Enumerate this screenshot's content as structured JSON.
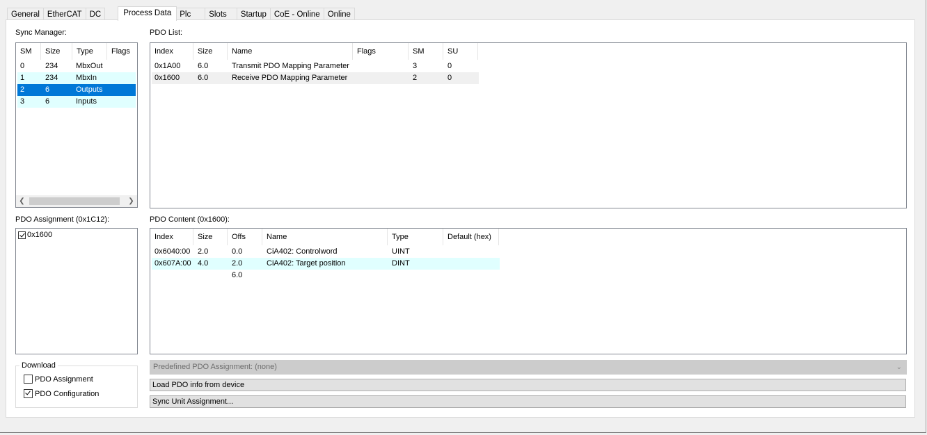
{
  "tabs": [
    "General",
    "EtherCAT",
    "DC",
    "Process Data",
    "Plc",
    "Slots",
    "Startup",
    "CoE - Online",
    "Online"
  ],
  "active_tab": "Process Data",
  "sync_manager": {
    "label": "Sync Manager:",
    "columns": [
      "SM",
      "Size",
      "Type",
      "Flags"
    ],
    "rows": [
      {
        "sm": "0",
        "size": "234",
        "type": "MbxOut",
        "flags": ""
      },
      {
        "sm": "1",
        "size": "234",
        "type": "MbxIn",
        "flags": ""
      },
      {
        "sm": "2",
        "size": "6",
        "type": "Outputs",
        "flags": ""
      },
      {
        "sm": "3",
        "size": "6",
        "type": "Inputs",
        "flags": ""
      }
    ]
  },
  "pdo_list": {
    "label": "PDO List:",
    "columns": [
      "Index",
      "Size",
      "Name",
      "Flags",
      "SM",
      "SU"
    ],
    "rows": [
      {
        "index": "0x1A00",
        "size": "6.0",
        "name": "Transmit PDO Mapping Parameter",
        "flags": "",
        "sm": "3",
        "su": "0"
      },
      {
        "index": "0x1600",
        "size": "6.0",
        "name": "Receive PDO Mapping Parameter",
        "flags": "",
        "sm": "2",
        "su": "0"
      }
    ]
  },
  "pdo_assignment": {
    "label": "PDO Assignment (0x1C12):",
    "items": [
      {
        "label": "0x1600",
        "checked": true
      }
    ]
  },
  "pdo_content": {
    "label": "PDO Content (0x1600):",
    "columns": [
      "Index",
      "Size",
      "Offs",
      "Name",
      "Type",
      "Default (hex)"
    ],
    "rows": [
      {
        "index": "0x6040:00",
        "size": "2.0",
        "offs": "0.0",
        "name": "CiA402: Controlword",
        "type": "UINT",
        "default": ""
      },
      {
        "index": "0x607A:00",
        "size": "4.0",
        "offs": "2.0",
        "name": "CiA402: Target position",
        "type": "DINT",
        "default": ""
      },
      {
        "index": "",
        "size": "",
        "offs": "6.0",
        "name": "",
        "type": "",
        "default": ""
      }
    ]
  },
  "download": {
    "title": "Download",
    "pdo_assignment_label": "PDO Assignment",
    "pdo_assignment_checked": false,
    "pdo_configuration_label": "PDO Configuration",
    "pdo_configuration_checked": true
  },
  "predefined_combo": "Predefined PDO Assignment: (none)",
  "load_button": "Load PDO info from device",
  "sync_unit_button": "Sync Unit Assignment...",
  "colors": {
    "selection": "#0078d7",
    "highlight": "#e0ffff"
  }
}
